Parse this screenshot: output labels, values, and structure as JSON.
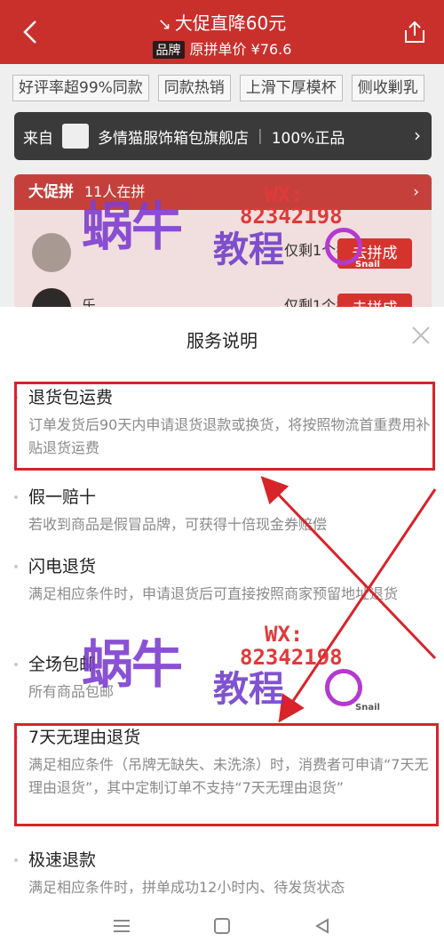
{
  "background": {
    "promo_title": "大促直降60元",
    "brand_tag": "品牌",
    "original_price": "原拼单价 ¥76.6",
    "chips": [
      "好评率超99%同款",
      "同款热销",
      "上滑下厚模杯",
      "侧收剿乳"
    ],
    "shop_prefix": "来自",
    "shop_name": "多情猫服饰箱包旗舰店",
    "shop_badge": "100%正品",
    "group_title": "大促拼",
    "group_count": "11人在拼",
    "group_row1_info": "仅剩1个名额",
    "group_join": "去拼成",
    "group_row2_info": "仅剩1个名额",
    "group_row2_user": "乐"
  },
  "sheet": {
    "title": "服务说明",
    "items": [
      {
        "title": "退货包运费",
        "desc": "订单发货后90天内申请退货退款或换货，将按照物流首重费用补贴退货运费"
      },
      {
        "title": "假一赔十",
        "desc": "若收到商品是假冒品牌，可获得十倍现金券赔偿"
      },
      {
        "title": "闪电退货",
        "desc": "满足相应条件时，申请退货后可直接按照商家预留地址退货"
      },
      {
        "title": "全场包邮",
        "desc": "所有商品包邮"
      },
      {
        "title": "7天无理由退货",
        "desc": "满足相应条件（吊牌无缺失、未洗涤）时，消费者可申请“7天无理由退货”，其中定制订单不支持“7天无理由退货”"
      },
      {
        "title": "极速退款",
        "desc": "满足相应条件时，拼单成功12小时内、待发货状态"
      }
    ]
  },
  "watermark": {
    "brand": "蜗牛",
    "sub": "教程",
    "contact": "WX:",
    "code": "82342198",
    "snail": "Snail"
  },
  "colors": {
    "accent": "#c9302c",
    "highlight": "#d8232a",
    "text_muted": "#8a8a8a"
  },
  "icons": [
    "back-arrow-icon",
    "share-icon",
    "close-icon",
    "menu-icon",
    "home-icon",
    "back-triangle-icon"
  ]
}
